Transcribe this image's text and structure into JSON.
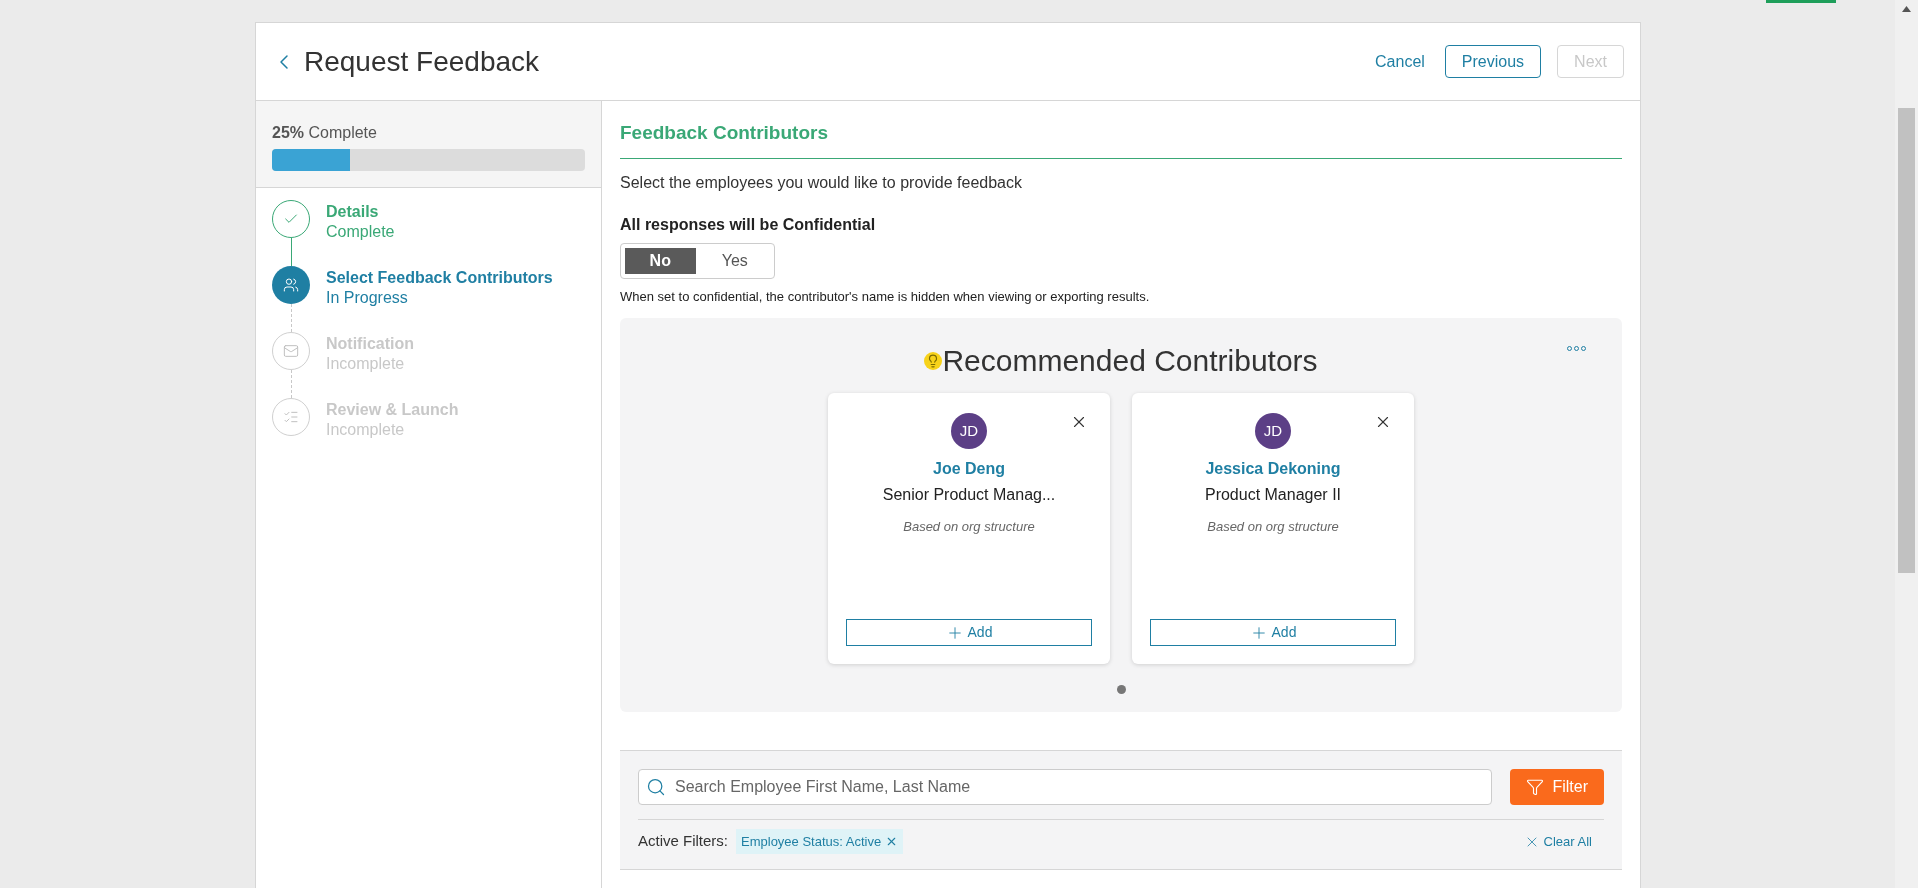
{
  "header": {
    "title": "Request Feedback",
    "cancel": "Cancel",
    "previous": "Previous",
    "next": {
      "label": "Next",
      "disabled": true
    }
  },
  "progress": {
    "percent": "25%",
    "label": "Complete",
    "level": 0.25
  },
  "steps": [
    {
      "title": "Details",
      "status": "Complete",
      "kind": "complete"
    },
    {
      "title": "Select Feedback Contributors",
      "status": "In Progress",
      "kind": "current"
    },
    {
      "title": "Notification",
      "status": "Incomplete",
      "kind": "incomplete"
    },
    {
      "title": "Review & Launch",
      "status": "Incomplete",
      "kind": "incomplete"
    }
  ],
  "section": {
    "title": "Feedback Contributors",
    "intro": "Select the employees you would like to provide feedback",
    "confidential": {
      "label": "All responses will be Confidential",
      "options": [
        {
          "label": "No",
          "selected": true
        },
        {
          "label": "Yes",
          "selected": false
        }
      ],
      "note": "When set to confidential, the contributor's name is hidden when viewing or exporting results."
    }
  },
  "recommended": {
    "title": "Recommended Contributors",
    "cards": [
      {
        "initials": "JD",
        "name": "Joe Deng",
        "role": "Senior Product Manag...",
        "reason": "Based on org structure",
        "add": "Add"
      },
      {
        "initials": "JD",
        "name": "Jessica Dekoning",
        "role": "Product Manager II",
        "reason": "Based on org structure",
        "add": "Add"
      }
    ],
    "pages": [
      {
        "selected": true
      }
    ]
  },
  "search": {
    "placeholder": "Search Employee First Name, Last Name",
    "filter": "Filter",
    "active_label": "Active Filters:",
    "filters": [
      "Employee Status: Active"
    ],
    "clear": "Clear All"
  }
}
